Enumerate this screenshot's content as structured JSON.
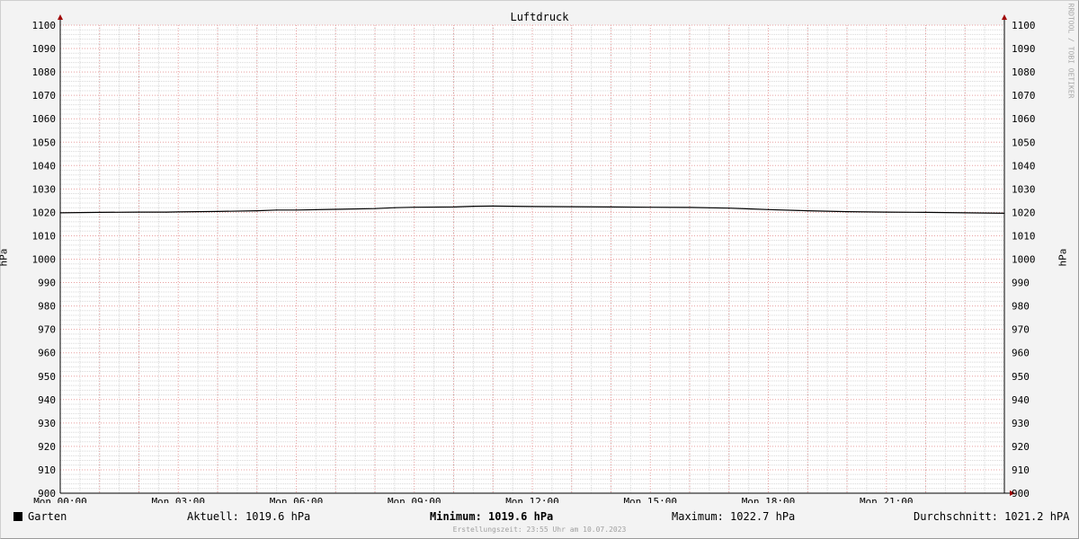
{
  "colors": {
    "line": "#000000",
    "major_grid": "#e8a0a0",
    "minor_grid": "#d8d8d8",
    "axis": "#000000",
    "arrow": "#a00000",
    "plot_bg": "#ffffff",
    "canvas_bg": "#f3f3f3"
  },
  "chart_data": {
    "type": "line",
    "title": "Luftdruck",
    "ylabel": "hPa",
    "ylim": [
      900,
      1100
    ],
    "yticks": [
      1100,
      1090,
      1080,
      1070,
      1060,
      1050,
      1040,
      1030,
      1020,
      1010,
      1000,
      990,
      980,
      970,
      960,
      950,
      940,
      930,
      920,
      910,
      900
    ],
    "x_range_hours": [
      0,
      24
    ],
    "x_ticks": [
      {
        "hour": 0,
        "label": "Mon 00:00"
      },
      {
        "hour": 3,
        "label": "Mon 03:00"
      },
      {
        "hour": 6,
        "label": "Mon 06:00"
      },
      {
        "hour": 9,
        "label": "Mon 09:00"
      },
      {
        "hour": 12,
        "label": "Mon 12:00"
      },
      {
        "hour": 15,
        "label": "Mon 15:00"
      },
      {
        "hour": 18,
        "label": "Mon 18:00"
      },
      {
        "hour": 21,
        "label": "Mon 21:00"
      }
    ],
    "grid": true,
    "series": [
      {
        "name": "Garten",
        "x": [
          0,
          1,
          2,
          2.7,
          3,
          4,
          5,
          5.5,
          6,
          7,
          8,
          8.5,
          9,
          10,
          10.5,
          11,
          12,
          13,
          14,
          15,
          16,
          17,
          17.5,
          18,
          19,
          20,
          21,
          22,
          23,
          24
        ],
        "y": [
          1019.8,
          1020.0,
          1020.1,
          1020.1,
          1020.2,
          1020.4,
          1020.7,
          1021.0,
          1021.0,
          1021.3,
          1021.6,
          1022.0,
          1022.2,
          1022.3,
          1022.6,
          1022.7,
          1022.5,
          1022.4,
          1022.3,
          1022.2,
          1022.1,
          1021.8,
          1021.5,
          1021.2,
          1020.7,
          1020.3,
          1020.1,
          1020.0,
          1019.8,
          1019.6
        ]
      }
    ]
  },
  "side_label": "hPa",
  "watermark": "RRDTOOL / TOBI OETIKER",
  "legend": {
    "series_name": "Garten",
    "current": "Aktuell: 1019.6 hPa",
    "minimum": "Minimum: 1019.6 hPa",
    "maximum": "Maximum: 1022.7 hPa",
    "average": "Durchschnitt: 1021.2 hPA"
  },
  "footer": "Erstellungszeit: 23:55 Uhr am 10.07.2023"
}
